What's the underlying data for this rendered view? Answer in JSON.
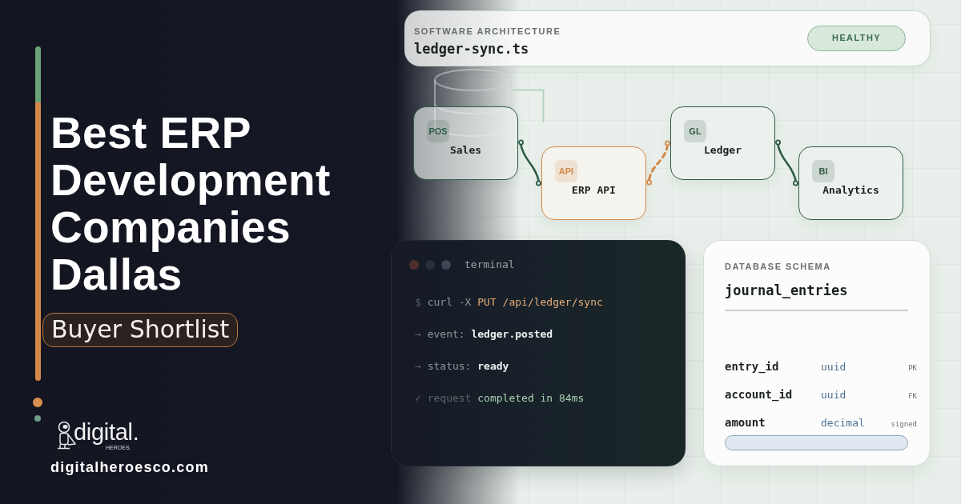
{
  "brand_panel": {
    "title": "Best ERP Development Companies Dallas",
    "tag": "Buyer Shortlist",
    "logo": {
      "wordmark": "digital.",
      "subline": "HEROES."
    },
    "url": "digitalheroesco.com"
  },
  "header": {
    "eyebrow": "SOFTWARE ARCHITECTURE",
    "filename": "ledger-sync.ts",
    "status": "HEALTHY"
  },
  "diagram": {
    "nodes": [
      {
        "badge": "POS",
        "label": "Sales",
        "color": "#2f5b47"
      },
      {
        "badge": "API",
        "label": "ERP API",
        "color": "#d4894a"
      },
      {
        "badge": "GL",
        "label": "Ledger",
        "color": "#2f5b47"
      },
      {
        "badge": "BI",
        "label": "Analytics",
        "color": "#2f5b47"
      }
    ],
    "connectors": [
      {
        "kind": "solid",
        "color": "#2f5b47"
      },
      {
        "kind": "dashed",
        "color": "#d4894a"
      },
      {
        "kind": "solid",
        "color": "#2f5b47"
      }
    ]
  },
  "terminal": {
    "title": "terminal",
    "window_dots": [
      {
        "color": "#4e312e"
      },
      {
        "color": "#28303b"
      },
      {
        "color": "#3b4756"
      }
    ],
    "lines": [
      {
        "parts": [
          {
            "kind": "prompt",
            "text": "$"
          },
          {
            "kind": "muted",
            "text": "curl -X"
          },
          {
            "kind": "accent",
            "text": "PUT /api/ledger/sync"
          }
        ]
      },
      {
        "parts": [
          {
            "kind": "prompt",
            "text": "→"
          },
          {
            "kind": "muted",
            "text": "event:"
          },
          {
            "kind": "value",
            "text": "ledger.posted"
          }
        ]
      },
      {
        "parts": [
          {
            "kind": "prompt",
            "text": "→"
          },
          {
            "kind": "muted",
            "text": "status:"
          },
          {
            "kind": "value",
            "text": "ready"
          }
        ]
      },
      {
        "parts": [
          {
            "kind": "prompt",
            "text": "✓"
          },
          {
            "kind": "dim",
            "text": "request"
          },
          {
            "kind": "success",
            "text": "completed in 84ms"
          }
        ]
      }
    ]
  },
  "schema": {
    "eyebrow": "DATABASE SCHEMA",
    "table": "journal_entries",
    "columns": [
      {
        "name": "entry_id",
        "type": "uuid",
        "key": "PK"
      },
      {
        "name": "account_id",
        "type": "uuid",
        "key": "FK"
      },
      {
        "name": "amount",
        "type": "decimal",
        "key": "signed"
      }
    ]
  }
}
